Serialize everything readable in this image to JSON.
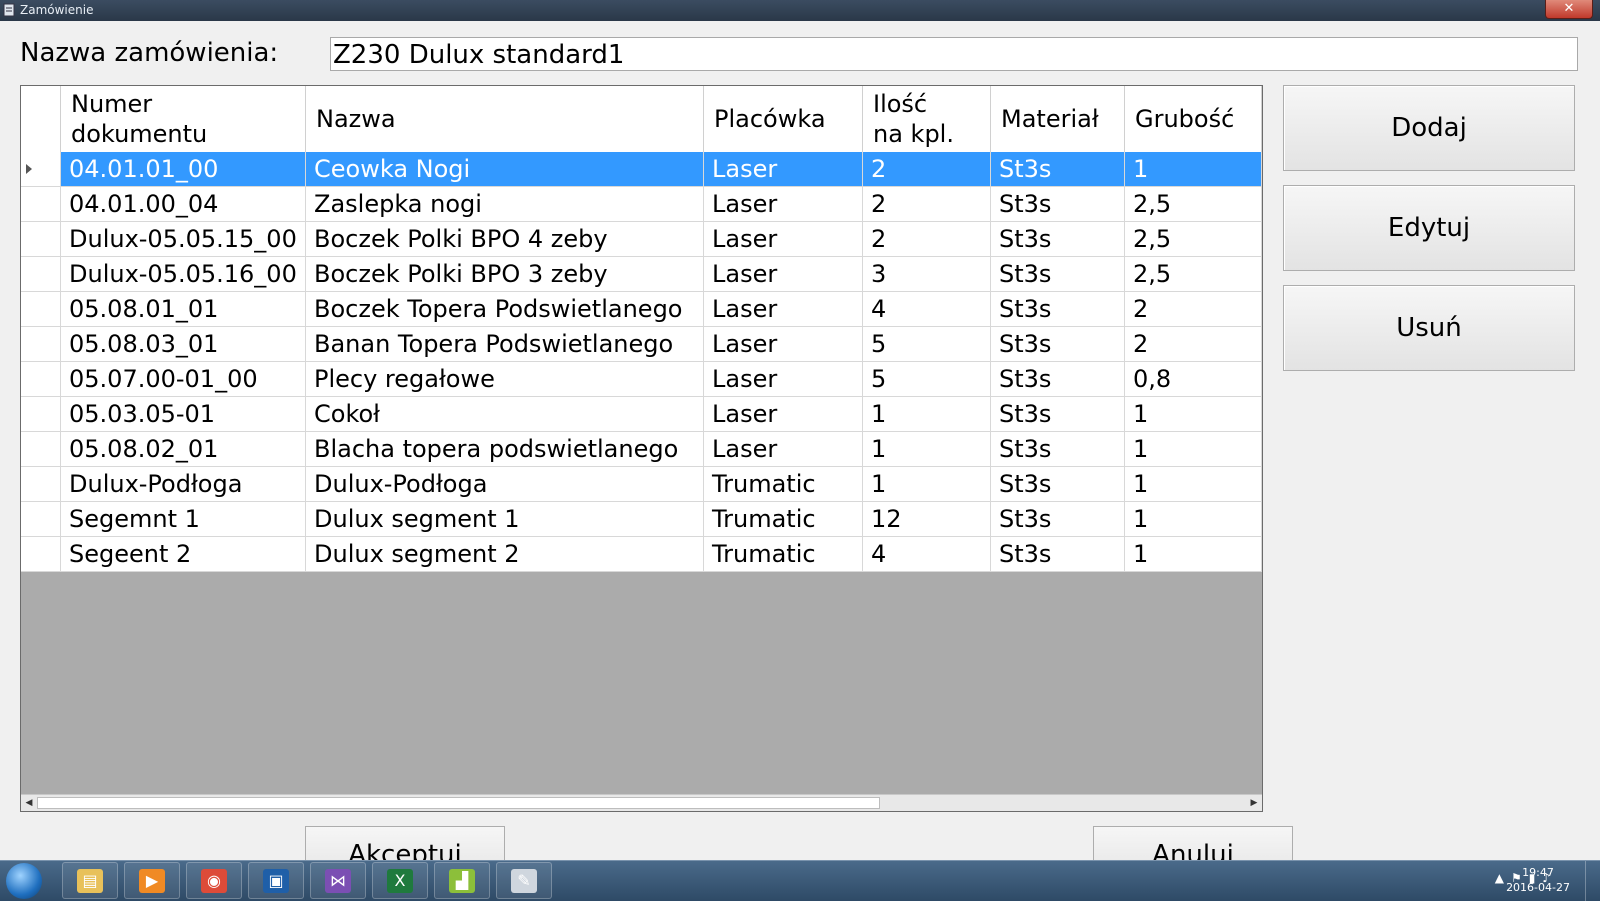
{
  "window": {
    "title": "Zamówienie",
    "close_label": "✕"
  },
  "order": {
    "name_label": "Nazwa zamówienia:",
    "name_value": "Z230 Dulux standard1"
  },
  "table": {
    "columns": [
      "Numer\ndokumentu",
      "Nazwa",
      "Placówka",
      "Ilość\nna kpl.",
      "Materiał",
      "Grubość"
    ],
    "selected_row": 0,
    "rows": [
      [
        "04.01.01_00",
        "Ceowka Nogi",
        "Laser",
        "2",
        "St3s",
        "1"
      ],
      [
        "04.01.00_04",
        "Zaslepka nogi",
        "Laser",
        "2",
        "St3s",
        "2,5"
      ],
      [
        "Dulux-05.05.15_00",
        "Boczek Polki BPO 4 zeby",
        "Laser",
        "2",
        "St3s",
        "2,5"
      ],
      [
        "Dulux-05.05.16_00",
        "Boczek Polki BPO 3 zeby",
        "Laser",
        "3",
        "St3s",
        "2,5"
      ],
      [
        "05.08.01_01",
        "Boczek Topera Podswietlanego",
        "Laser",
        "4",
        "St3s",
        "2"
      ],
      [
        "05.08.03_01",
        "Banan Topera Podswietlanego",
        "Laser",
        "5",
        "St3s",
        "2"
      ],
      [
        "05.07.00-01_00",
        "Plecy regałowe",
        "Laser",
        "5",
        "St3s",
        "0,8"
      ],
      [
        "05.03.05-01",
        "Cokoł",
        "Laser",
        "1",
        "St3s",
        "1"
      ],
      [
        "05.08.02_01",
        "Blacha topera podswietlanego",
        "Laser",
        "1",
        "St3s",
        "1"
      ],
      [
        "Dulux-Podłoga",
        "Dulux-Podłoga",
        "Trumatic",
        "1",
        "St3s",
        "1"
      ],
      [
        "Segemnt 1",
        "Dulux segment 1",
        "Trumatic",
        "12",
        "St3s",
        "1"
      ],
      [
        "Segeent 2",
        "Dulux segment 2",
        "Trumatic",
        "4",
        "St3s",
        "1"
      ]
    ]
  },
  "actions": {
    "add": "Dodaj",
    "edit": "Edytuj",
    "delete": "Usuń",
    "accept": "Akceptuj",
    "cancel": "Anuluj"
  },
  "taskbar": {
    "apps": [
      "file-explorer-icon",
      "media-player-icon",
      "chrome-icon",
      "save-app-icon",
      "visual-studio-icon",
      "excel-icon",
      "chart-app-icon",
      "notepad-icon"
    ],
    "time": "19:47",
    "date": "2016-04-27"
  },
  "colors": {
    "selection": "#3399ff",
    "grid_empty": "#ababab",
    "titlebar": "#2f3e50"
  }
}
